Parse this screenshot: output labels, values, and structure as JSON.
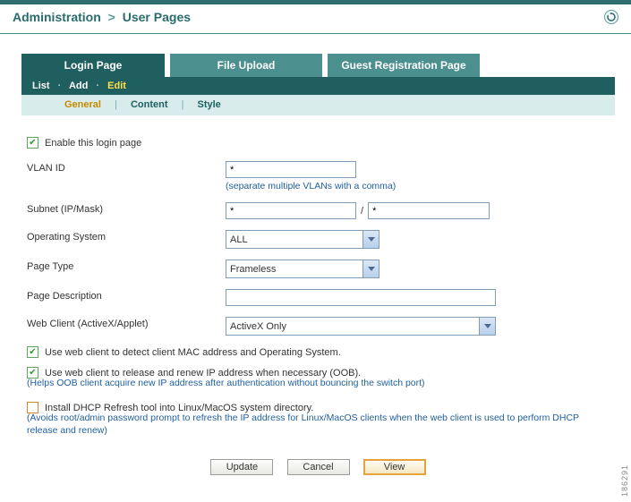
{
  "breadcrumb": {
    "section": "Administration",
    "page": "User Pages"
  },
  "tabs1": {
    "login": "Login Page",
    "upload": "File Upload",
    "guest": "Guest Registration Page"
  },
  "tabs2": {
    "list": "List",
    "add": "Add",
    "edit": "Edit"
  },
  "tabs3": {
    "general": "General",
    "content": "Content",
    "style": "Style"
  },
  "form": {
    "enable_label": "Enable this login page",
    "vlan_label": "VLAN ID",
    "vlan_value": "*",
    "vlan_hint": "(separate multiple VLANs with a comma)",
    "subnet_label": "Subnet (IP/Mask)",
    "subnet_ip": "*",
    "subnet_mask": "*",
    "os_label": "Operating System",
    "os_value": "ALL",
    "pagetype_label": "Page Type",
    "pagetype_value": "Frameless",
    "pagedesc_label": "Page Description",
    "pagedesc_value": "",
    "webclient_label": "Web Client (ActiveX/Applet)",
    "webclient_value": "ActiveX Only",
    "chk_detect": "Use web client to detect client MAC address and Operating System.",
    "chk_release": "Use web client to release and renew IP address when necessary (OOB).",
    "chk_release_note": "(Helps OOB client acquire new IP address after authentication without bouncing the switch port)",
    "chk_dhcp": "Install DHCP Refresh tool into Linux/MacOS system directory.",
    "chk_dhcp_note": "(Avoids root/admin password prompt to refresh the IP address for Linux/MacOS clients when the web client is used to perform DHCP release and renew)"
  },
  "buttons": {
    "update": "Update",
    "cancel": "Cancel",
    "view": "View"
  },
  "image_id": "186291"
}
